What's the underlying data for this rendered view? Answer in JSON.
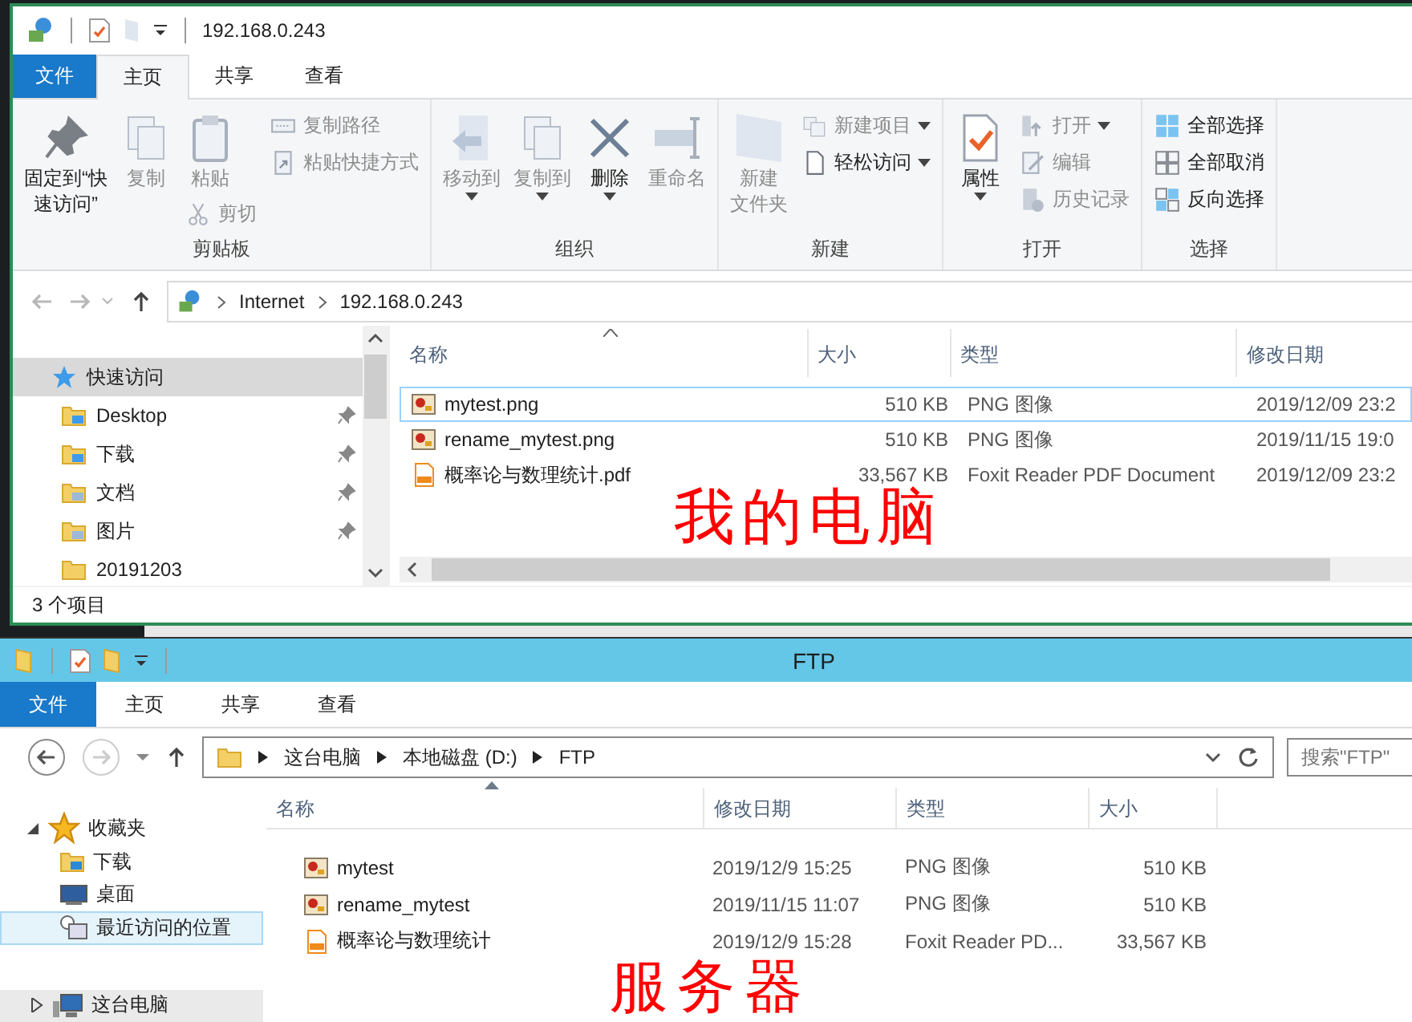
{
  "annotations": [
    {
      "text": "我的电脑"
    },
    {
      "text": "服务器"
    }
  ],
  "top_window": {
    "title": "192.168.0.243",
    "tabs": [
      {
        "label": "文件",
        "kind": "menu",
        "selected": false
      },
      {
        "label": "主页",
        "kind": "tab",
        "selected": true
      },
      {
        "label": "共享",
        "kind": "tab",
        "selected": false
      },
      {
        "label": "查看",
        "kind": "tab",
        "selected": false
      }
    ],
    "ribbon": [
      {
        "label": "剪贴板",
        "columns": [
          [
            {
              "lines": [
                "固定到“快",
                "速访问”"
              ],
              "kind": "large",
              "disabled": false,
              "dropdown": false
            }
          ],
          [
            {
              "lines": [
                "复制"
              ],
              "kind": "large",
              "disabled": true,
              "dropdown": false
            }
          ],
          [
            {
              "lines": [
                "粘贴"
              ],
              "kind": "large",
              "disabled": true,
              "dropdown": false
            },
            {
              "label": "剪切",
              "kind": "small",
              "disabled": true,
              "dropdown": false
            }
          ],
          [
            {
              "label": "复制路径",
              "kind": "small",
              "disabled": true,
              "dropdown": false
            },
            {
              "label": "粘贴快捷方式",
              "kind": "small",
              "disabled": true,
              "dropdown": false
            }
          ]
        ]
      },
      {
        "label": "组织",
        "columns": [
          [
            {
              "lines": [
                "移动到"
              ],
              "kind": "large",
              "disabled": true,
              "dropdown": true
            }
          ],
          [
            {
              "lines": [
                "复制到"
              ],
              "kind": "large",
              "disabled": true,
              "dropdown": true
            }
          ],
          [
            {
              "lines": [
                "删除"
              ],
              "kind": "large",
              "disabled": false,
              "dropdown": true
            }
          ],
          [
            {
              "lines": [
                "重命名"
              ],
              "kind": "large",
              "disabled": true,
              "dropdown": false
            }
          ]
        ]
      },
      {
        "label": "新建",
        "columns": [
          [
            {
              "lines": [
                "新建",
                "文件夹"
              ],
              "kind": "large",
              "disabled": true,
              "dropdown": false
            }
          ],
          [
            {
              "label": "新建项目",
              "kind": "small",
              "disabled": true,
              "dropdown": true
            },
            {
              "label": "轻松访问",
              "kind": "small",
              "disabled": false,
              "dropdown": true
            }
          ]
        ]
      },
      {
        "label": "打开",
        "columns": [
          [
            {
              "lines": [
                "属性"
              ],
              "kind": "large",
              "disabled": false,
              "dropdown": true
            }
          ],
          [
            {
              "label": "打开",
              "kind": "small",
              "disabled": true,
              "dropdown": true
            },
            {
              "label": "编辑",
              "kind": "small",
              "disabled": true,
              "dropdown": false
            },
            {
              "label": "历史记录",
              "kind": "small",
              "disabled": true,
              "dropdown": false
            }
          ]
        ]
      },
      {
        "label": "选择",
        "columns": [
          [
            {
              "label": "全部选择",
              "kind": "small",
              "disabled": false,
              "dropdown": false
            },
            {
              "label": "全部取消",
              "kind": "small",
              "disabled": false,
              "dropdown": false
            },
            {
              "label": "反向选择",
              "kind": "small",
              "disabled": false,
              "dropdown": false
            }
          ]
        ]
      }
    ],
    "address": [
      "Internet",
      "192.168.0.243"
    ],
    "nav": [
      {
        "label": "快速访问",
        "selected": true,
        "children": [
          {
            "label": "Desktop",
            "pinned": true,
            "selected": false
          },
          {
            "label": "下载",
            "pinned": true,
            "selected": false
          },
          {
            "label": "文档",
            "pinned": true,
            "selected": false
          },
          {
            "label": "图片",
            "pinned": true,
            "selected": false
          },
          {
            "label": "20191203",
            "pinned": false,
            "selected": false
          }
        ]
      }
    ],
    "columns": [
      {
        "label": "名称",
        "kind": "name",
        "sorted": true
      },
      {
        "label": "大小",
        "kind": "size",
        "sorted": false
      },
      {
        "label": "类型",
        "kind": "type",
        "sorted": false
      },
      {
        "label": "修改日期",
        "kind": "date",
        "sorted": false
      }
    ],
    "rows": [
      {
        "kind": "image",
        "focused": true,
        "cells": [
          "mytest.png",
          "510 KB",
          "PNG 图像",
          "2019/12/09 23:2"
        ]
      },
      {
        "kind": "image",
        "focused": false,
        "cells": [
          "rename_mytest.png",
          "510 KB",
          "PNG 图像",
          "2019/11/15 19:0"
        ]
      },
      {
        "kind": "pdf",
        "focused": false,
        "cells": [
          "概率论与数理统计.pdf",
          "33,567 KB",
          "Foxit Reader PDF Document",
          "2019/12/09 23:2"
        ]
      }
    ],
    "status": "3 个项目"
  },
  "bottom_window": {
    "title": "FTP",
    "tabs": [
      {
        "label": "文件",
        "kind": "menu",
        "selected": false
      },
      {
        "label": "主页",
        "kind": "tab",
        "selected": false
      },
      {
        "label": "共享",
        "kind": "tab",
        "selected": false
      },
      {
        "label": "查看",
        "kind": "tab",
        "selected": false
      }
    ],
    "address": [
      "这台电脑",
      "本地磁盘 (D:)",
      "FTP"
    ],
    "search": {
      "placeholder": "搜索\"FTP\""
    },
    "nav": [
      {
        "label": "收藏夹",
        "expanded": true,
        "selected": false,
        "children": [
          {
            "label": "下载",
            "selected": false
          },
          {
            "label": "桌面",
            "selected": false
          },
          {
            "label": "最近访问的位置",
            "selected": true
          }
        ]
      },
      {
        "label": "这台电脑",
        "expanded": false,
        "selected": false
      }
    ],
    "columns": [
      {
        "label": "名称",
        "kind": "name",
        "sorted": true
      },
      {
        "label": "修改日期",
        "kind": "date",
        "sorted": false
      },
      {
        "label": "类型",
        "kind": "type",
        "sorted": false
      },
      {
        "label": "大小",
        "kind": "size",
        "sorted": false
      }
    ],
    "rows": [
      {
        "kind": "image",
        "focused": false,
        "cells": [
          "mytest",
          "2019/12/9 15:25",
          "PNG 图像",
          "510 KB"
        ]
      },
      {
        "kind": "image",
        "focused": false,
        "cells": [
          "rename_mytest",
          "2019/11/15 11:07",
          "PNG 图像",
          "510 KB"
        ]
      },
      {
        "kind": "pdf",
        "focused": false,
        "cells": [
          "概率论与数理统计",
          "2019/12/9 15:28",
          "Foxit Reader PD...",
          "33,567 KB"
        ]
      }
    ]
  }
}
